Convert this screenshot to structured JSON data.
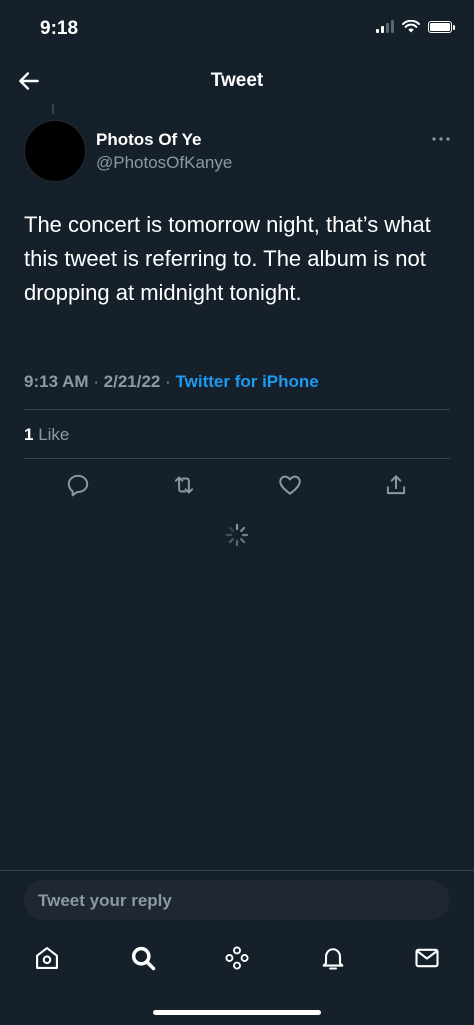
{
  "status_bar": {
    "time": "9:18"
  },
  "header": {
    "title": "Tweet"
  },
  "tweet": {
    "author_name": "Photos Of Ye",
    "author_handle": "@PhotosOfKanye",
    "text": "The concert is tomorrow night, that’s what this tweet is referring to. The album is not dropping at midnight tonight.",
    "time": "9:13 AM",
    "date": "2/21/22",
    "source": "Twitter for iPhone",
    "separator": " · ",
    "like_count": "1",
    "like_label": "Like"
  },
  "reply": {
    "placeholder": "Tweet your reply"
  },
  "tab_bar": {
    "icons": [
      "home-icon",
      "search-icon",
      "spaces-icon",
      "notifications-icon",
      "messages-icon"
    ]
  },
  "colors": {
    "background": "#15202b",
    "accent": "#1d9bf0",
    "secondary_text": "#8b98a5",
    "border": "#38444d"
  }
}
